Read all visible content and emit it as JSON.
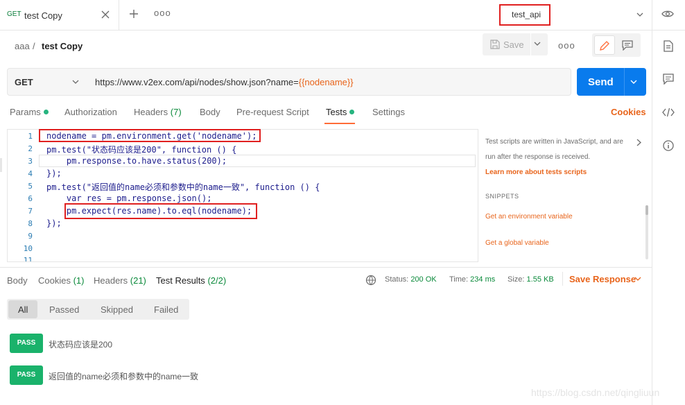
{
  "tab": {
    "method": "GET",
    "name": "test Copy"
  },
  "environment": {
    "name": "test_api"
  },
  "breadcrumb": {
    "collection": "aaa",
    "separator": "/",
    "request": "test Copy"
  },
  "toolbar": {
    "save_label": "Save",
    "more": "ooo"
  },
  "request": {
    "method": "GET",
    "url_prefix": "https://www.v2ex.com/api/nodes/show.json?name=",
    "url_variable": "{{nodename}}",
    "send_label": "Send"
  },
  "request_tabs": [
    {
      "label": "Params",
      "count": "",
      "dot": true
    },
    {
      "label": "Authorization",
      "count": ""
    },
    {
      "label": "Headers",
      "count": "(7)"
    },
    {
      "label": "Body",
      "count": ""
    },
    {
      "label": "Pre-request Script",
      "count": ""
    },
    {
      "label": "Tests",
      "count": "",
      "dot": true,
      "active": true
    },
    {
      "label": "Settings",
      "count": ""
    }
  ],
  "cookies_label": "Cookies",
  "code_lines": [
    {
      "n": "1",
      "text": "nodename = pm.environment.get('nodename');"
    },
    {
      "n": "2",
      "text": "pm.test(\"状态码应该是200\", function () {"
    },
    {
      "n": "3",
      "text": "    pm.response.to.have.status(200);"
    },
    {
      "n": "4",
      "text": "});"
    },
    {
      "n": "5",
      "text": "pm.test(\"返回值的name必须和参数中的name一致\", function () {"
    },
    {
      "n": "6",
      "text": "    var res = pm.response.json();"
    },
    {
      "n": "7",
      "text": "    pm.expect(res.name).to.eql(nodename);"
    },
    {
      "n": "8",
      "text": "});"
    },
    {
      "n": "9",
      "text": ""
    },
    {
      "n": "10",
      "text": ""
    },
    {
      "n": "11",
      "text": ""
    }
  ],
  "snippets": {
    "description": "Test scripts are written in JavaScript, and are run after the response is received.",
    "learn_more": "Learn more about tests scripts",
    "heading": "SNIPPETS",
    "items": [
      "Get an environment variable",
      "Get a global variable"
    ]
  },
  "response_tabs": [
    {
      "label": "Body",
      "count": ""
    },
    {
      "label": "Cookies",
      "count": "(1)"
    },
    {
      "label": "Headers",
      "count": "(21)"
    },
    {
      "label": "Test Results",
      "count": "(2/2)",
      "active": true
    }
  ],
  "status": {
    "status_label": "Status:",
    "status_value": "200 OK",
    "time_label": "Time:",
    "time_value": "234 ms",
    "size_label": "Size:",
    "size_value": "1.55 KB"
  },
  "save_response_label": "Save Response",
  "filters": [
    "All",
    "Passed",
    "Skipped",
    "Failed"
  ],
  "results": [
    {
      "badge": "PASS",
      "name": "状态码应该是200"
    },
    {
      "badge": "PASS",
      "name": "返回值的name必须和参数中的name一致"
    }
  ],
  "watermark": "https://blog.csdn.net/qingliuun",
  "colors": {
    "accent": "#ff6c37",
    "send": "#097bed",
    "pass": "#1ab26b",
    "highlight_box": "#e02020"
  }
}
